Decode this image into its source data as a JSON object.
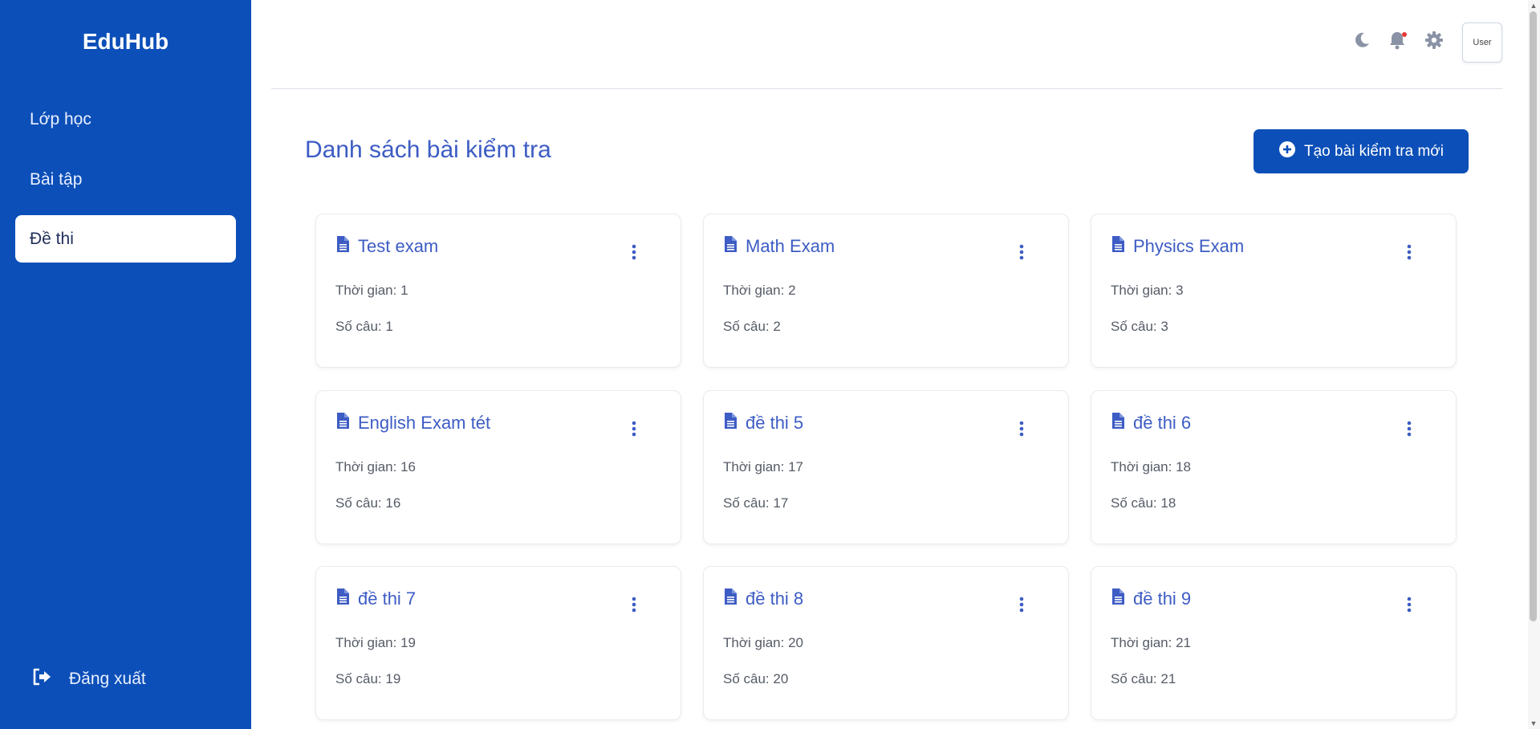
{
  "sidebar": {
    "brand": "EduHub",
    "items": [
      {
        "label": "Lớp học"
      },
      {
        "label": "Bài tập"
      },
      {
        "label": "Đề thi"
      }
    ],
    "logout_label": "Đăng xuất"
  },
  "header": {
    "user_label": "User"
  },
  "main": {
    "title": "Danh sách bài kiểm tra",
    "create_button_label": "Tạo bài kiểm tra mới",
    "cards": [
      {
        "title": "Test exam",
        "time": "Thời gian: 1",
        "questions": "Số câu: 1"
      },
      {
        "title": "Math Exam",
        "time": "Thời gian: 2",
        "questions": "Số câu: 2"
      },
      {
        "title": "Physics Exam",
        "time": "Thời gian: 3",
        "questions": "Số câu: 3"
      },
      {
        "title": "English Exam tét",
        "time": "Thời gian: 16",
        "questions": "Số câu: 16"
      },
      {
        "title": "đề thi 5",
        "time": "Thời gian: 17",
        "questions": "Số câu: 17"
      },
      {
        "title": "đề thi 6",
        "time": "Thời gian: 18",
        "questions": "Số câu: 18"
      },
      {
        "title": "đề thi 7",
        "time": "Thời gian: 19",
        "questions": "Số câu: 19"
      },
      {
        "title": "đề thi 8",
        "time": "Thời gian: 20",
        "questions": "Số câu: 20"
      },
      {
        "title": "đề thi 9",
        "time": "Thời gian: 21",
        "questions": "Số câu: 21"
      }
    ]
  },
  "colors": {
    "sidebar_bg": "#0c4fb8",
    "accent_text": "#3d5cc4",
    "notification_dot": "#e53935"
  },
  "icons": {
    "theme": "moon-icon",
    "notifications": "bell-icon",
    "settings": "gear-icon",
    "logout": "logout-icon",
    "card": "document-icon",
    "card_menu": "more-vertical-icon",
    "create": "plus-circle-icon"
  }
}
